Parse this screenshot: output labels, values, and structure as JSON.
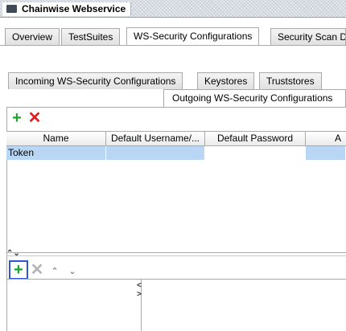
{
  "window": {
    "title": "Chainwise Webservice"
  },
  "main_tabs": [
    {
      "label": "Overview"
    },
    {
      "label": "TestSuites"
    },
    {
      "label": "WS-Security Configurations"
    },
    {
      "label": "Security Scan D"
    }
  ],
  "sub_tabs": [
    {
      "label": "Incoming WS-Security Configurations"
    },
    {
      "label": "Keystores"
    },
    {
      "label": "Truststores"
    },
    {
      "label": "Outgoing WS-Security Configurations"
    }
  ],
  "outgoing_toolbar": {
    "add_glyph": "+",
    "remove_glyph": "✕"
  },
  "table": {
    "columns": [
      "Name",
      "Default Username/...",
      "Default Password",
      "A"
    ],
    "rows": [
      {
        "name": "Token",
        "username": "",
        "password": "",
        "a": ""
      }
    ]
  },
  "splitter": {
    "glyph": "⌃⌄"
  },
  "entries_toolbar": {
    "add_glyph": "+",
    "remove_glyph": "✕",
    "up_glyph": "⌃",
    "down_glyph": "⌄"
  },
  "pane_splitter_glyph": "<>",
  "colors": {
    "selection": "#b9d6f4",
    "add": "#1aa62d",
    "remove": "#e02020",
    "highlight": "#2f55d4"
  }
}
